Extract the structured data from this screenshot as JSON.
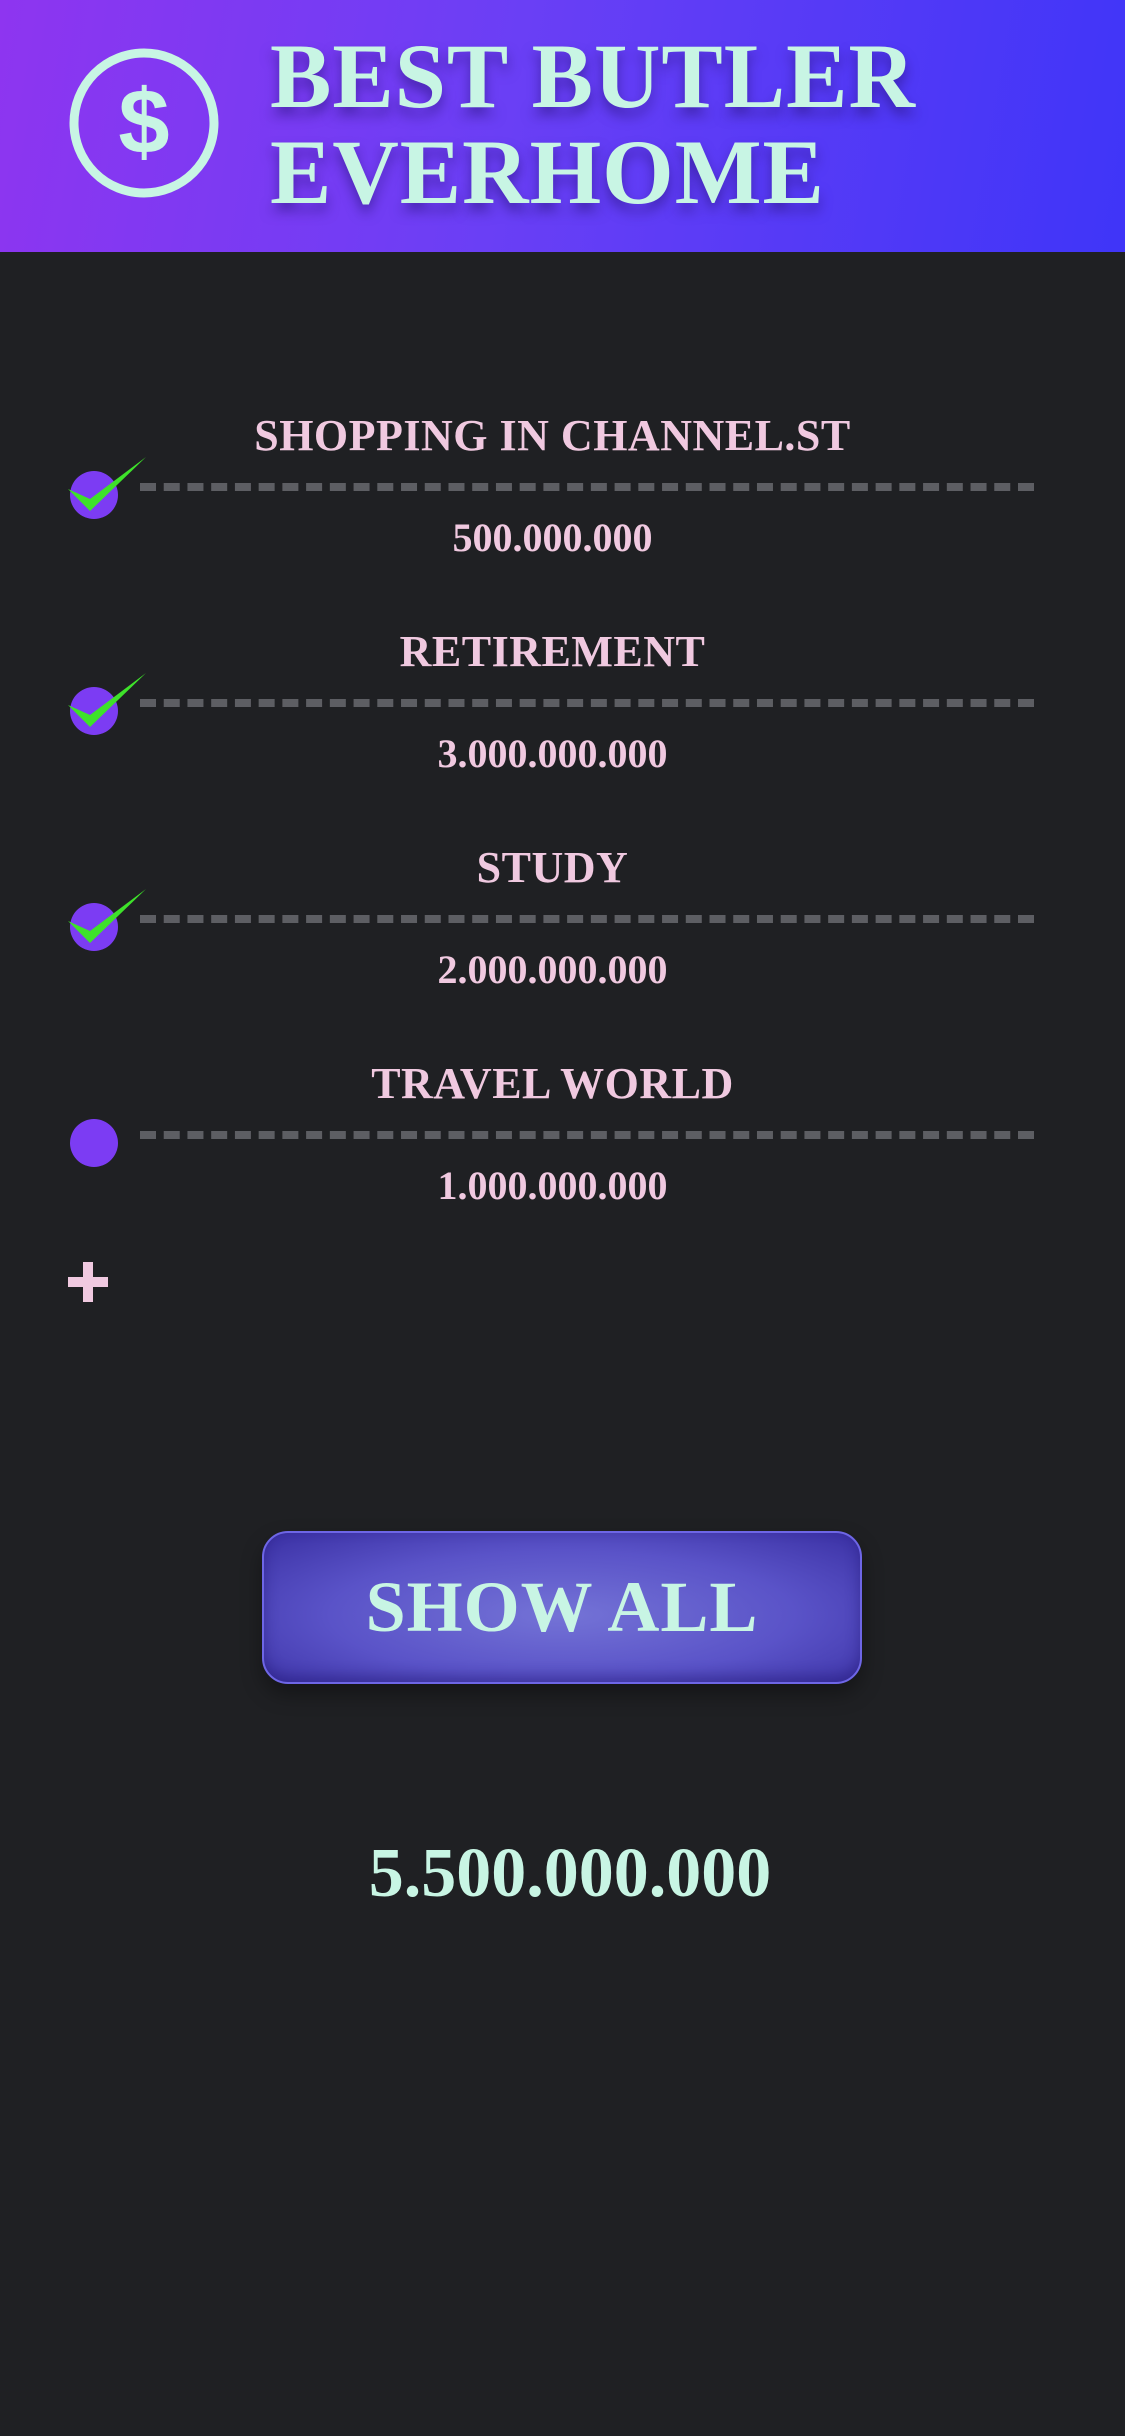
{
  "header": {
    "title_line1": "BEST BUTLER",
    "title_line2": "EVERHOME",
    "logo_icon": "dollar-circle-icon"
  },
  "goals": [
    {
      "title": "SHOPPING IN CHANNEL.ST",
      "amount": "500.000.000",
      "completed": true
    },
    {
      "title": "RETIREMENT",
      "amount": "3.000.000.000",
      "completed": true
    },
    {
      "title": "STUDY",
      "amount": "2.000.000.000",
      "completed": true
    },
    {
      "title": "TRAVEL WORLD",
      "amount": "1.000.000.000",
      "completed": false
    }
  ],
  "add_icon": "plus-icon",
  "show_all_label": "SHOW ALL",
  "total": "5.500.000.000",
  "colors": {
    "background": "#1f2023",
    "header_gradient_start": "#8e35f0",
    "header_gradient_end": "#3f35f8",
    "title_text": "#c8f5e4",
    "goal_text": "#f0c9e0",
    "dot": "#7c3cf3",
    "check": "#3ee22a",
    "button": "#5a53c8"
  }
}
